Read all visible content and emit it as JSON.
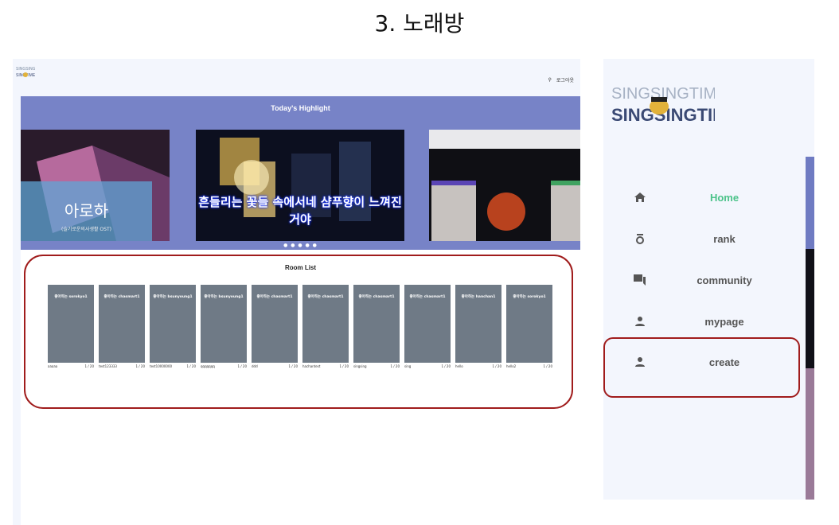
{
  "slide": {
    "title": "3. 노래방"
  },
  "app": {
    "logo_text_top": "SINGSINGTIME",
    "logo_text_bottom": "SINGSINGTIME",
    "top_right_label": "로그아웃"
  },
  "highlight": {
    "title": "Today's Highlight",
    "card1_title": "아로하",
    "card1_subtitle": "(슬기로운의사생활 OST)",
    "card2_lyric": "흔들리는 꽃들 속에서네 샴푸향이 느껴진 거야",
    "dots": "● ● ● ● ●"
  },
  "room_list": {
    "title": "Room List",
    "rooms": [
      {
        "caption": "좋아하는 sorokyo1",
        "name": "aaaaa",
        "count": "1 / 20"
      },
      {
        "caption": "좋아하는 chasmart1",
        "name": "test123333",
        "count": "1 / 20"
      },
      {
        "caption": "좋아하는 bsunyoung1",
        "name": "test10000000",
        "count": "1 / 20"
      },
      {
        "caption": "좋아하는 bsunyoung1",
        "name": "qqqqqqq",
        "count": "1 / 20"
      },
      {
        "caption": "좋아하는 chasmart1",
        "name": "ddd",
        "count": "1 / 20"
      },
      {
        "caption": "좋아하는 chasmart1",
        "name": "hachantest",
        "count": "1 / 20"
      },
      {
        "caption": "좋아하는 chasmart1",
        "name": "singsing",
        "count": "1 / 20"
      },
      {
        "caption": "좋아하는 chasmart1",
        "name": "sing",
        "count": "1 / 20"
      },
      {
        "caption": "좋아하는 hanchan1",
        "name": "hello",
        "count": "1 / 20"
      },
      {
        "caption": "좋아하는 sorokyo1",
        "name": "hello2",
        "count": "1 / 20"
      }
    ]
  },
  "sidebar": {
    "items": [
      {
        "label": "Home",
        "icon": "home-icon"
      },
      {
        "label": "rank",
        "icon": "rank-icon"
      },
      {
        "label": "community",
        "icon": "chat-icon"
      },
      {
        "label": "mypage",
        "icon": "person-icon"
      },
      {
        "label": "create",
        "icon": "person-icon"
      }
    ]
  },
  "colors": {
    "accent": "#7783c7",
    "active_nav": "#4cc38a",
    "annotation": "#a01c1c"
  }
}
